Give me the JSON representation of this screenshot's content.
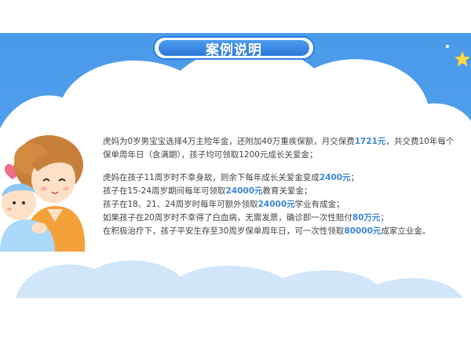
{
  "title": "案例说明",
  "para1": {
    "text_a": "虎妈为0岁男宝宝选择4万主险年金，还附加40万重疾保额，月交保费",
    "hl_a": "1721元",
    "text_b": "，共交费10年每个保单周年日（含满期），孩子均可领取1200元成长关爱金；"
  },
  "lines": [
    {
      "pre": "虎妈在孩子11周岁时不幸身故，则余下每年成长关爱金变成",
      "hl": "2400元",
      "post": "；"
    },
    {
      "pre": "孩子在15-24周岁期间每年可领取",
      "hl": "24000元",
      "post": "教育关爱金；"
    },
    {
      "pre": "孩子在18、21、24周岁时每年可额外领取",
      "hl": "24000元",
      "post": "学业有成金；"
    },
    {
      "pre": "如果孩子在20周岁时不幸得了白血病，无需发票，确诊即一次性赔付",
      "hl": "80万元",
      "post": "；"
    },
    {
      "pre": "在积极治疗下，孩子平安生存至30周岁保单周年日，可一次性领取",
      "hl": "80000元",
      "post": "成家立业金。"
    }
  ],
  "colors": {
    "banner": "#4a9aea",
    "title_fill": "#2c78d8",
    "highlight": "#3a86dc",
    "text": "#444444",
    "star": "#ffd83a"
  }
}
